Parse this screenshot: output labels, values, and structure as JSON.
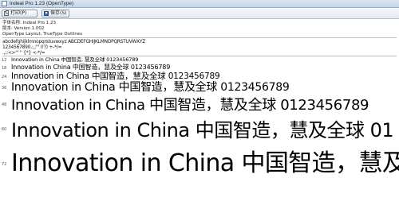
{
  "window": {
    "title": "Indeal Pro 1.23 (OpenType)"
  },
  "toolbar": {
    "print_label": "打印(P)",
    "save_label": "保存(S)",
    "print_icon": "printer-icon",
    "save_icon": "save-icon"
  },
  "info": {
    "font_name": "字体名称: Indeal Pro 1.23",
    "version": "版本: Version 1.002",
    "features": "OpenType Layout, TrueType Outlines"
  },
  "charset": {
    "line1": "abcdefghijklmnopqrstuvwxyz ABCDEFGHIJKLMNOPQRSTUVWXYZ",
    "line2": "1234567890.:,;'\" (!?) +-*/=",
    "line3": ".,;:<>\"' '' {*} <-*/="
  },
  "samples": [
    {
      "size": "12",
      "text": "Innovation in China 中国智造, 慧及全球 0123456789"
    },
    {
      "size": "18",
      "text": "Innovation in China 中国智造，慧及全球 0123456789"
    },
    {
      "size": "24",
      "text": "Innovation in China 中国智造，慧及全球 0123456789"
    },
    {
      "size": "36",
      "text": "Innovation in China 中国智造，慧及全球 0123456789"
    },
    {
      "size": "48",
      "text": "Innovation in China 中国智造，慧及全球 0123456789"
    },
    {
      "size": "60",
      "text": "Innovation in China 中国智造，慧及全球 01"
    },
    {
      "size": "72",
      "text": "Innovation in China 中国智造，慧及全球"
    }
  ]
}
